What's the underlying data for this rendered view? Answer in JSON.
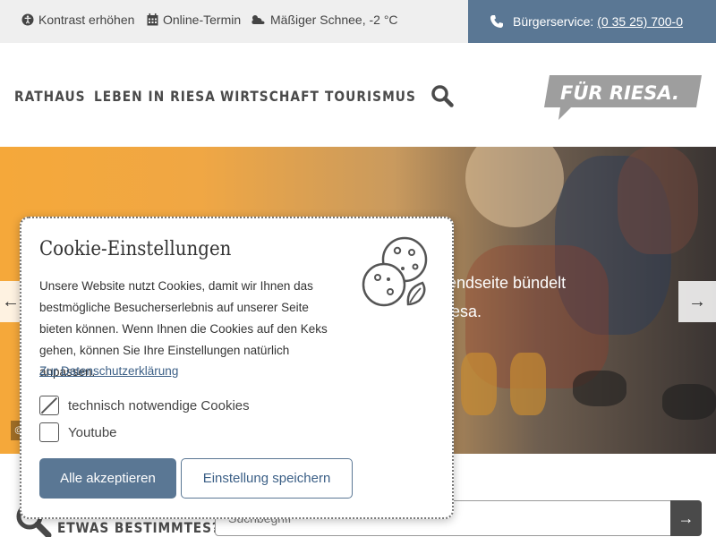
{
  "topbar": {
    "contrast": "Kontrast erhöhen",
    "appointment": "Online-Termin",
    "weather": "Mäßiger Schnee, -2 °C",
    "service_label": "Bürgerservice:",
    "service_phone": "(0 35 25) 700-0"
  },
  "nav": {
    "items": [
      "RATHAUS",
      "LEBEN IN RIESA",
      "WIRTSCHAFT",
      "TOURISMUS"
    ],
    "logo_text": "FÜR RIESA."
  },
  "hero": {
    "text_line1": "endseite bündelt",
    "text_line2": "iesa.",
    "prev_arrow": "←",
    "next_arrow": "→",
    "copyright": "©"
  },
  "search": {
    "label": "ETWAS BESTIMMTES?",
    "placeholder": "Suchbegriff",
    "go": "→"
  },
  "cookie": {
    "title": "Cookie-Einstellungen",
    "text": "Unsere Website nutzt Cookies, damit wir Ihnen das bestmögliche Besucherserlebnis auf unserer Seite bieten können. Wenn Ihnen die Cookies auf den Keks gehen, können Sie Ihre Einstellungen natürlich anpassen.",
    "privacy_link": "Zur Datenschutzerklärung",
    "options": [
      {
        "label": "technisch notwendige Cookies",
        "checked": true,
        "disabled": true
      },
      {
        "label": "Youtube",
        "checked": false,
        "disabled": false
      }
    ],
    "accept_all": "Alle akzeptieren",
    "save": "Einstellung speichern"
  },
  "colors": {
    "accent": "#5a7794",
    "link": "#3b5f86",
    "hero_orange": "#f5a83a"
  }
}
